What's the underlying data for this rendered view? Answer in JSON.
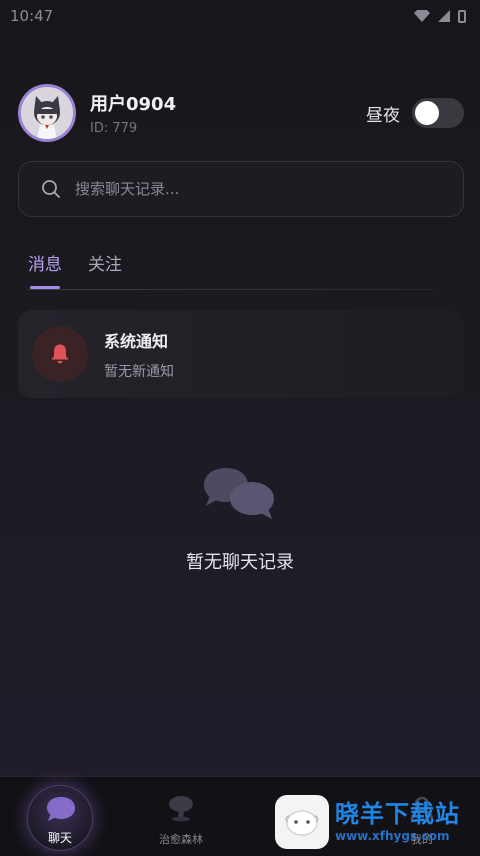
{
  "status_bar": {
    "time": "10:47"
  },
  "profile": {
    "username": "用户0904",
    "id_label": "ID: 779"
  },
  "theme": {
    "label": "昼夜",
    "enabled": false
  },
  "search": {
    "placeholder": "搜索聊天记录..."
  },
  "tabs": [
    {
      "label": "消息",
      "active": true
    },
    {
      "label": "关注",
      "active": false
    }
  ],
  "notification": {
    "title": "系统通知",
    "subtitle": "暂无新通知"
  },
  "empty_state": {
    "text": "暂无聊天记录"
  },
  "tabbar": [
    {
      "label": "聊天",
      "active": true,
      "icon": "chat-icon"
    },
    {
      "label": "治愈森林",
      "active": false,
      "icon": "tree-icon"
    },
    {
      "label": "我的",
      "active": false,
      "icon": "profile-icon"
    }
  ],
  "watermark": {
    "brand": "晓羊下载站",
    "url": "www.xfhygs.com"
  },
  "colors": {
    "accent": "#a48be6",
    "bell": "#e0525a",
    "background": "#1b1a20",
    "watermark": "#1f86e6"
  }
}
